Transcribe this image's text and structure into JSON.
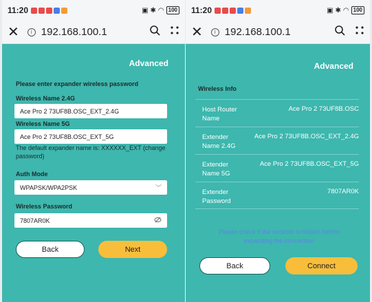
{
  "statusbar": {
    "time": "11:20",
    "battery": "100"
  },
  "browser": {
    "url": "192.168.100.1"
  },
  "left": {
    "advanced": "Advanced",
    "prompt": "Please enter expander wireless password",
    "name24_label": "Wireless Name 2.4G",
    "name24_value": "Ace Pro 2 73UF8B.OSC_EXT_2.4G",
    "name5_label": "Wireless Name 5G",
    "name5_value": "Ace Pro 2 73UF8B.OSC_EXT_5G",
    "hint": "The default expander name is: XXXXXX_EXT (change password)",
    "auth_label": "Auth Mode",
    "auth_value": "WPAPSK/WPA2PSK",
    "pwd_label": "Wireless Password",
    "pwd_value": "7807AR0K",
    "back": "Back",
    "next": "Next"
  },
  "right": {
    "advanced": "Advanced",
    "section_title": "Wireless Info",
    "rows": [
      {
        "key": "Host Router Name",
        "value": "Ace Pro 2 73UF8B.OSC"
      },
      {
        "key": "Extender Name 2.4G",
        "value": "Ace Pro 2 73UF8B.OSC_EXT_2.4G"
      },
      {
        "key": "Extender Name 5G",
        "value": "Ace Pro 2 73UF8B.OSC_EXT_5G"
      },
      {
        "key": "Extender Password",
        "value": "7807AR0K"
      }
    ],
    "note": "Please check if the network is hidden before expanding the connection",
    "back": "Back",
    "connect": "Connect"
  },
  "colors": {
    "teal": "#3eb7ae",
    "accent": "#f8be3b",
    "note": "#5b86e5"
  },
  "icons": [
    "close-icon",
    "info-icon",
    "search-icon",
    "more-icon",
    "chevron-down-icon",
    "eye-off-icon"
  ]
}
